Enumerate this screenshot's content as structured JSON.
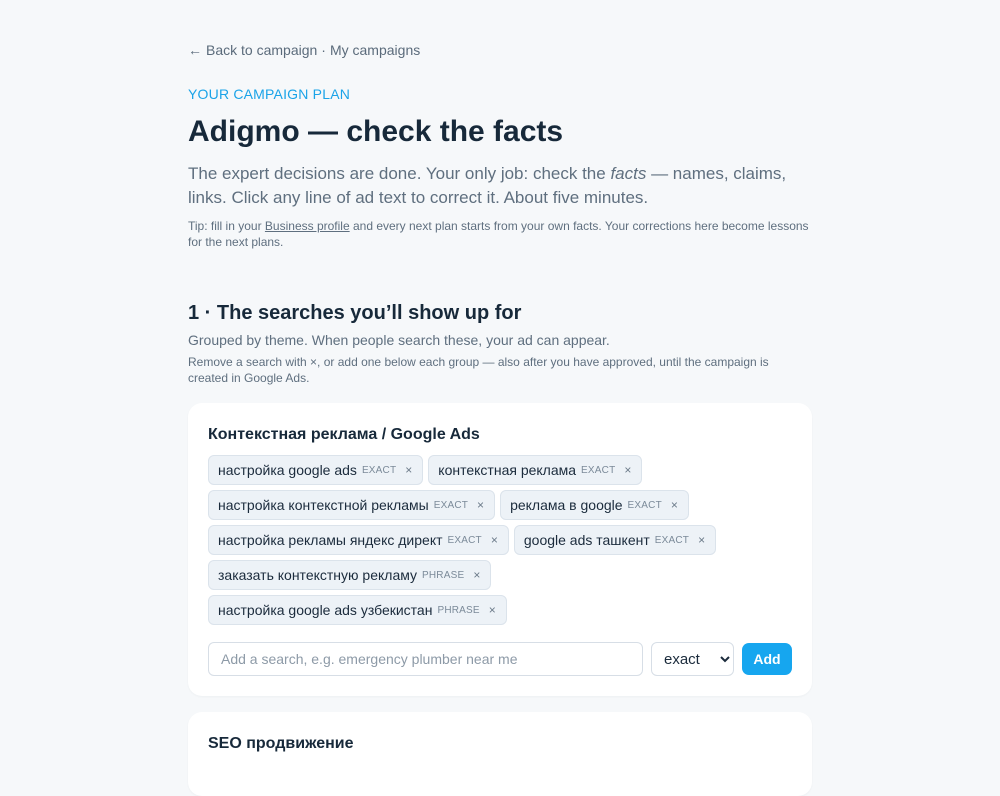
{
  "nav": {
    "arrow": "←",
    "back_link": "Back to campaign",
    "separator": "·",
    "campaigns_link": "My campaigns"
  },
  "eyebrow": "YOUR CAMPAIGN PLAN",
  "title": "Adigmo — check the facts",
  "lead": {
    "before": "The expert decisions are done. Your only job: check the ",
    "emph": "facts",
    "after": " — names, claims, links. Click any line of ad text to correct it. About five minutes."
  },
  "tip": {
    "before": "Tip: fill in your ",
    "link": "Business profile",
    "after": " and every next plan starts from your own facts. Your corrections here become lessons for the next plans."
  },
  "section1": {
    "title": "1 · The searches you’ll show up for",
    "subtitle": "Grouped by theme. When people search these, your ad can appear.",
    "note": "Remove a search with ×, or add one below each group — also after you have approved, until the campaign is created in Google Ads."
  },
  "groups": [
    {
      "title": "Контекстная реклама / Google Ads",
      "keywords": [
        {
          "text": "настройка google ads",
          "match": "EXACT"
        },
        {
          "text": "контекстная реклама",
          "match": "EXACT"
        },
        {
          "text": "настройка контекстной рекламы",
          "match": "EXACT"
        },
        {
          "text": "реклама в google",
          "match": "EXACT"
        },
        {
          "text": "настройка рекламы яндекс директ",
          "match": "EXACT"
        },
        {
          "text": "google ads ташкент",
          "match": "EXACT"
        },
        {
          "text": "заказать контекстную рекламу",
          "match": "PHRASE"
        },
        {
          "text": "настройка google ads узбекистан",
          "match": "PHRASE"
        }
      ],
      "remove_symbol": "×",
      "add_placeholder": "Add a search, e.g. emergency plumber near me",
      "match_select": "exact",
      "add_button": "Add"
    },
    {
      "title": "SEO продвижение"
    }
  ]
}
